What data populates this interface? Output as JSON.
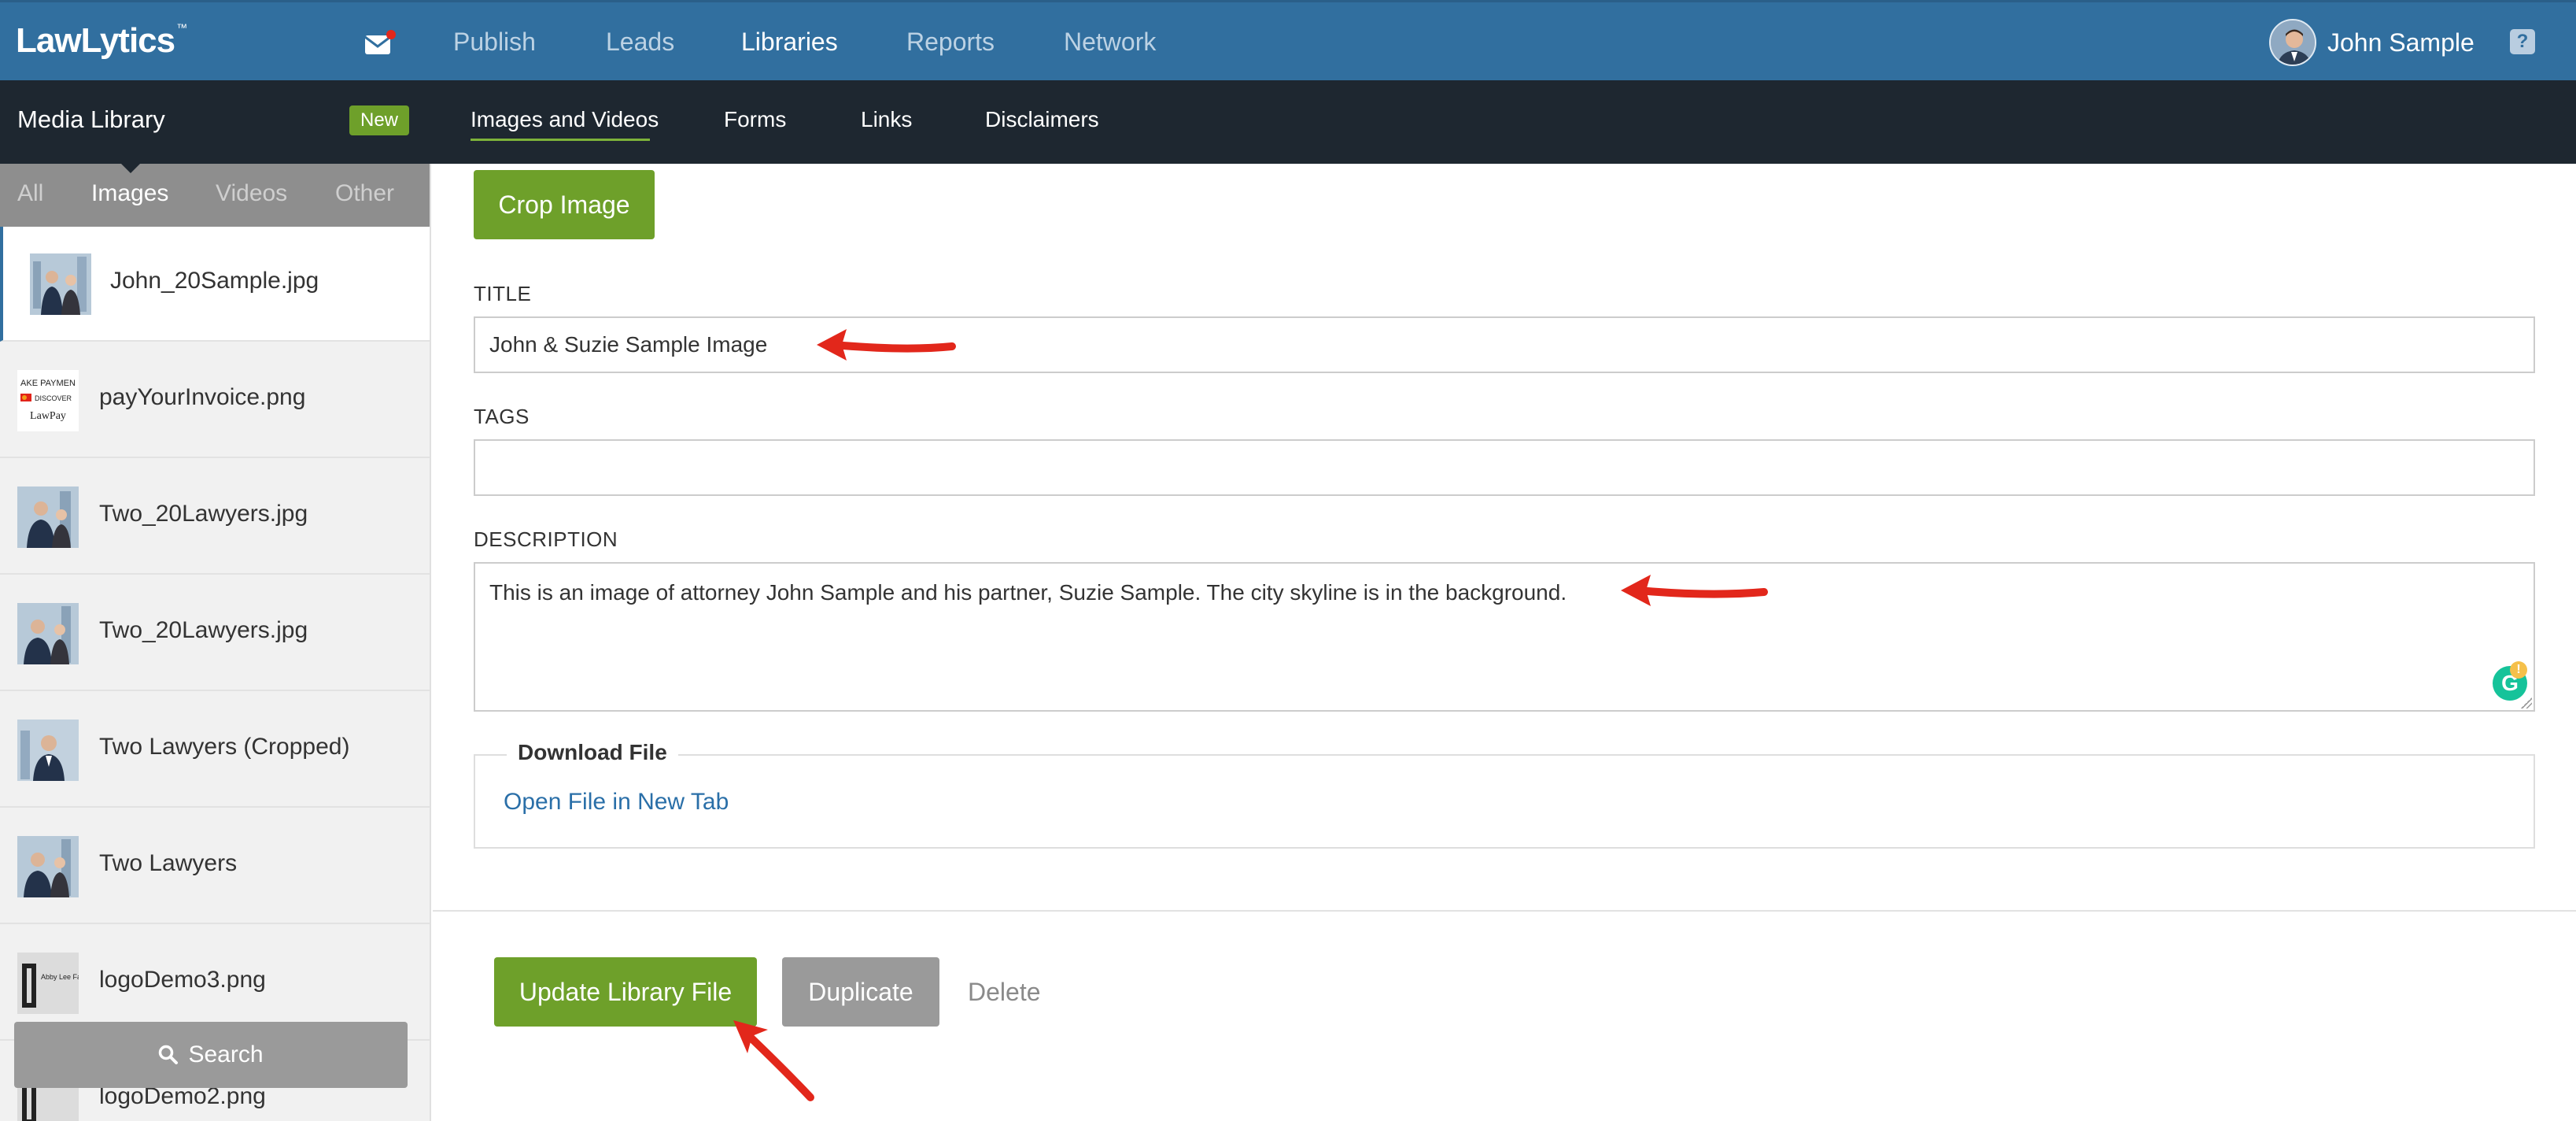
{
  "app": {
    "logo": "LawLytics",
    "logo_mark": "™"
  },
  "topnav": {
    "items": [
      "Publish",
      "Leads",
      "Libraries",
      "Reports",
      "Network"
    ],
    "active": "Libraries",
    "user_name": "John Sample",
    "help_label": "?"
  },
  "subnav": {
    "title": "Media Library",
    "badge": "New",
    "items": [
      "Images and Videos",
      "Forms",
      "Links",
      "Disclaimers"
    ],
    "active": "Images and Videos"
  },
  "sidebar": {
    "filters": [
      "All",
      "Images",
      "Videos",
      "Other"
    ],
    "active_filter": "Images",
    "files": [
      {
        "name": "John_20Sample.jpg",
        "selected": true
      },
      {
        "name": "payYourInvoice.png"
      },
      {
        "name": "Two_20Lawyers.jpg"
      },
      {
        "name": "Two_20Lawyers.jpg"
      },
      {
        "name": "Two Lawyers (Cropped)"
      },
      {
        "name": "Two Lawyers"
      },
      {
        "name": "logoDemo3.png"
      },
      {
        "name": "logoDemo2.png"
      }
    ],
    "thumb_text": {
      "invoice_top": "AKE PAYMEN",
      "invoice_card": "DISCOVER",
      "invoice_bottom": "LawPay",
      "logo_text": "Abby Lee Family Blog"
    },
    "search_label": "Search"
  },
  "editor": {
    "crop_label": "Crop Image",
    "title_label": "TITLE",
    "title_value": "John & Suzie Sample Image",
    "tags_label": "TAGS",
    "tags_value": "",
    "description_label": "DESCRIPTION",
    "description_value": "This is an image of attorney John Sample and his partner, Suzie Sample. The city skyline is in the background.",
    "download_legend": "Download File",
    "download_link": "Open File in New Tab",
    "grammarly_letter": "G",
    "grammarly_alert": "!"
  },
  "actions": {
    "update_label": "Update Library File",
    "duplicate_label": "Duplicate",
    "delete_label": "Delete"
  },
  "colors": {
    "topnav": "#316f9f",
    "subnav": "#1e2730",
    "accent_green": "#6ea02a",
    "annotation_red": "#e2271b",
    "link_blue": "#2a6fa8"
  }
}
